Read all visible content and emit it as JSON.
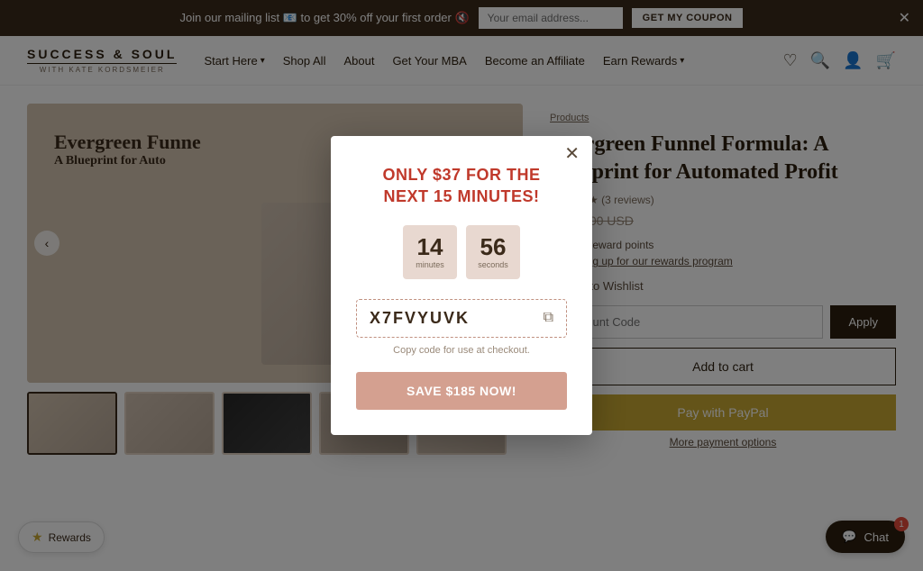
{
  "announcement": {
    "text": "Join our mailing list 📧 to get 30% off your first order 🔇",
    "input_placeholder": "Your email address...",
    "button_label": "GET MY COUPON"
  },
  "header": {
    "logo_main": "SUCCESS & SOUL",
    "logo_sub": "WITH KATE KORDSMEIER",
    "nav_items": [
      {
        "label": "Start Here",
        "has_dropdown": true
      },
      {
        "label": "Shop All",
        "has_dropdown": false
      },
      {
        "label": "About",
        "has_dropdown": false
      },
      {
        "label": "Get Your MBA",
        "has_dropdown": false
      },
      {
        "label": "Become an Affiliate",
        "has_dropdown": false
      },
      {
        "label": "Earn Rewards",
        "has_dropdown": true
      }
    ]
  },
  "breadcrumb": {
    "text": "Products"
  },
  "product": {
    "title": "Evergreen Funnel Formula: A Blueprint for Automated Profit",
    "reviews": "(3 reviews)",
    "price_original": "$222.00 USD",
    "rewards_points": "get 222 reward points",
    "rewards_link": "by signing up for our rewards program",
    "wishlist_label": "Add to Wishlist",
    "discount_placeholder": "Discount Code",
    "apply_label": "Apply",
    "add_cart_label": "Add to cart",
    "paypal_label": "Pay with PayPal",
    "more_payment_label": "More payment options"
  },
  "thumbnails": [
    {
      "label": "Thumbnail 1"
    },
    {
      "label": "Thumbnail 2"
    },
    {
      "label": "Thumbnail 3"
    },
    {
      "label": "Thumbnail 4"
    },
    {
      "label": "Thumbnail 5"
    }
  ],
  "modal": {
    "headline_line1": "ONLY $37 FOR THE",
    "headline_line2": "NEXT 15 MINUTES!",
    "timer_minutes": "14",
    "timer_minutes_label": "Minutes",
    "timer_seconds": "56",
    "timer_seconds_label": "Seconds",
    "coupon_code": "X7FVYUVK",
    "copy_hint": "Copy code for use at checkout.",
    "save_button_label": "SAVE $185 NOW!"
  },
  "rewards": {
    "label": "Rewards"
  },
  "chat": {
    "label": "Chat",
    "badge": "1"
  }
}
